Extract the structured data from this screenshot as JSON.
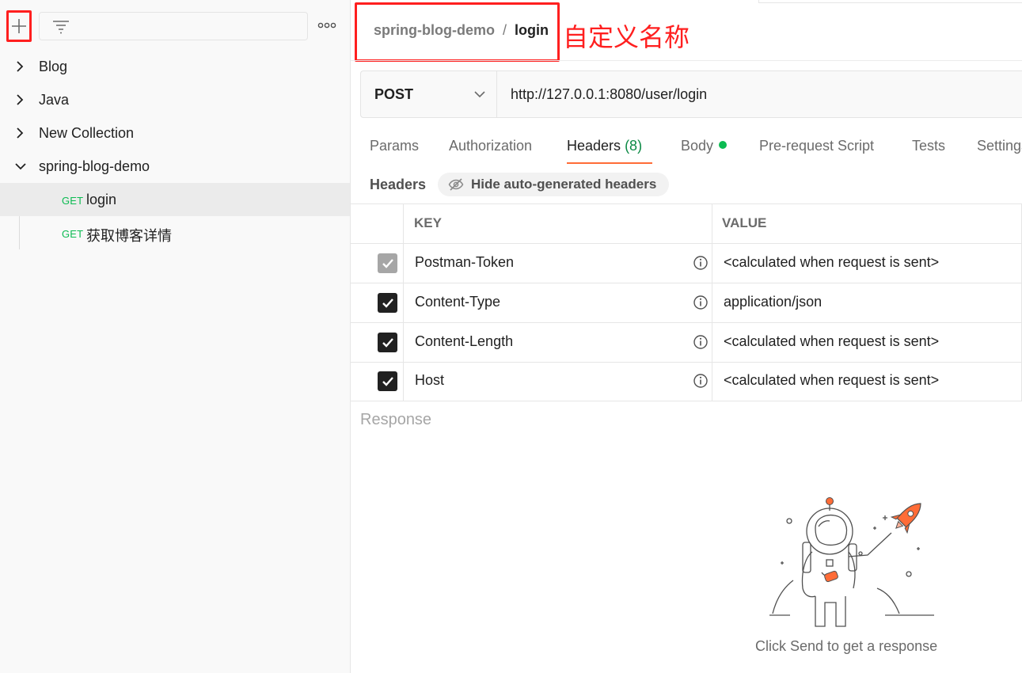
{
  "sidebar": {
    "new_button_icon": "plus-icon",
    "filter_icon": "filter-icon",
    "more_icon": "more-horizontal-icon",
    "collections": [
      {
        "label": "Blog",
        "expanded": false
      },
      {
        "label": "Java",
        "expanded": false
      },
      {
        "label": "New Collection",
        "expanded": false
      },
      {
        "label": "spring-blog-demo",
        "expanded": true
      }
    ],
    "requests": [
      {
        "method": "GET",
        "label": "login",
        "active": true
      },
      {
        "method": "GET",
        "label": "获取博客详情",
        "active": false
      }
    ]
  },
  "header": {
    "breadcrumb_collection": "spring-blog-demo",
    "breadcrumb_separator": "/",
    "breadcrumb_request": "login",
    "annotation": "自定义名称"
  },
  "request": {
    "method": "POST",
    "url": "http://127.0.0.1:8080/user/login"
  },
  "tabs": {
    "params": "Params",
    "authorization": "Authorization",
    "headers": "Headers",
    "headers_count": "(8)",
    "body": "Body",
    "pre_request": "Pre-request Script",
    "tests": "Tests",
    "settings": "Settings",
    "active": "Headers"
  },
  "headers_section": {
    "title": "Headers",
    "toggle_label": "Hide auto-generated headers",
    "columns": {
      "key": "KEY",
      "value": "VALUE"
    },
    "rows": [
      {
        "key": "Postman-Token",
        "value": "<calculated when request is sent>",
        "checked": true,
        "disabled": true
      },
      {
        "key": "Content-Type",
        "value": "application/json",
        "checked": true,
        "disabled": false
      },
      {
        "key": "Content-Length",
        "value": "<calculated when request is sent>",
        "checked": true,
        "disabled": false
      },
      {
        "key": "Host",
        "value": "<calculated when request is sent>",
        "checked": true,
        "disabled": false
      }
    ]
  },
  "response": {
    "label": "Response",
    "empty_message": "Click Send to get a response"
  },
  "colors": {
    "accent": "#ff6c37",
    "get_method": "#0cbb52",
    "annotation_red": "#ff1f1f"
  }
}
